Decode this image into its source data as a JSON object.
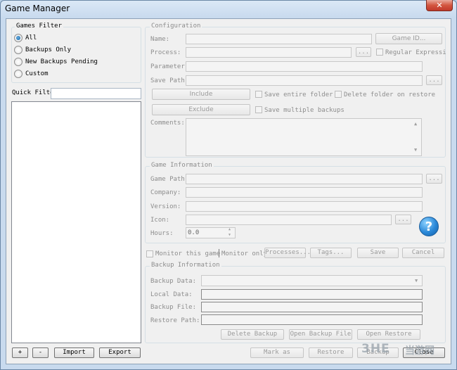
{
  "window": {
    "title": "Game Manager",
    "close_glyph": "✕"
  },
  "games_filter": {
    "title": "Games Filter",
    "options": [
      {
        "label": "All",
        "checked": true
      },
      {
        "label": "Backups Only",
        "checked": false
      },
      {
        "label": "New Backups Pending",
        "checked": false
      },
      {
        "label": "Custom",
        "checked": false
      }
    ]
  },
  "quick_filter": {
    "label": "Quick Filter:",
    "value": ""
  },
  "list_buttons": {
    "add": "+",
    "remove": "-",
    "import": "Import",
    "export": "Export"
  },
  "configuration": {
    "title": "Configuration",
    "name_label": "Name:",
    "game_id_button": "Game ID...",
    "process_label": "Process:",
    "browse": "...",
    "regex_label": "Regular Expression",
    "parameter_label": "Parameter:",
    "save_path_label": "Save Path:",
    "include_button": "Include",
    "exclude_button": "Exclude",
    "save_entire_folder": "Save entire folder",
    "delete_folder_on_restore": "Delete folder on restore",
    "save_multiple_backups": "Save multiple backups",
    "comments_label": "Comments:"
  },
  "game_information": {
    "title": "Game Information",
    "game_path_label": "Game Path:",
    "company_label": "Company:",
    "version_label": "Version:",
    "icon_label": "Icon:",
    "hours_label": "Hours:",
    "hours_value": "0.0",
    "help_glyph": "?"
  },
  "actions": {
    "monitor_this_game": "Monitor this game",
    "monitor_only": "Monitor only",
    "processes": "Processes...",
    "tags": "Tags...",
    "save": "Save",
    "cancel": "Cancel"
  },
  "backup_information": {
    "title": "Backup Information",
    "backup_data_label": "Backup Data:",
    "local_data_label": "Local Data:",
    "backup_file_label": "Backup File:",
    "restore_path_label": "Restore Path:",
    "delete_backup": "Delete Backup",
    "open_backup_file": "Open Backup File",
    "open_restore": "Open Restore"
  },
  "bottom": {
    "mark_as": "Mark as",
    "restore": "Restore",
    "backup": "Backup",
    "close": "Close"
  },
  "watermark": {
    "logo": "3HE",
    "site": "当游网"
  }
}
